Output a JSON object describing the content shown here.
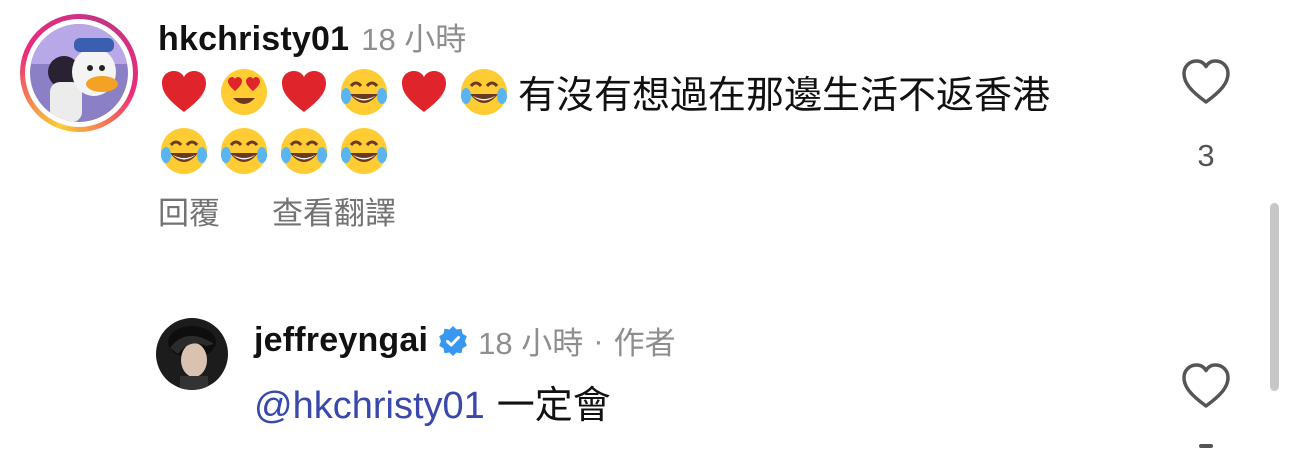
{
  "comments": [
    {
      "username": "hkchristy01",
      "time": "18 小時",
      "emojis_line1": [
        "red-heart",
        "heart-eyes",
        "red-heart",
        "tears-of-joy",
        "red-heart",
        "tears-of-joy"
      ],
      "text": "有沒有想過在那邊生活不返香港",
      "emojis_line2": [
        "tears-of-joy",
        "tears-of-joy",
        "tears-of-joy",
        "tears-of-joy"
      ],
      "actions": {
        "reply": "回覆",
        "translate": "查看翻譯"
      },
      "like_count": "3"
    },
    {
      "username": "jeffreyngai",
      "verified": true,
      "time": "18 小時",
      "separator": "·",
      "author_badge": "作者",
      "mention": "@hkchristy01",
      "text": "一定會"
    }
  ],
  "colors": {
    "mention": "#3949ab",
    "verified": "#3897f0",
    "muted": "#8e8e8e",
    "heart_red": "#e0242b",
    "emoji_yellow": "#ffcc33"
  }
}
